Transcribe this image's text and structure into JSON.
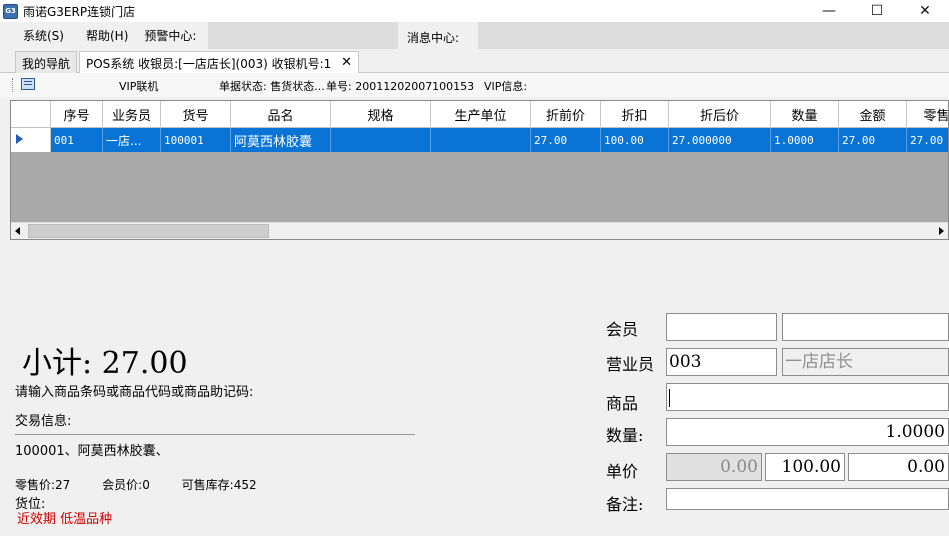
{
  "window": {
    "title": "雨诺G3ERP连锁门店",
    "icon_text": "G3",
    "controls": [
      "—",
      "☐",
      "✕"
    ]
  },
  "menu": {
    "items": [
      "系统(S)",
      "帮助(H)",
      "预警中心:"
    ],
    "message_center": "消息中心:"
  },
  "tabs": [
    {
      "label": "我的导航"
    },
    {
      "label": "POS系统 收银员:[一店店长](003) 收银机号:1",
      "close": "✕"
    }
  ],
  "toolbar": {
    "vip_mode": "VIP联机",
    "doc_status": "单据状态: 售货状态...",
    "doc_no": "单号: 20011202007100153",
    "vip_info": "VIP信息:"
  },
  "grid": {
    "columns": [
      "序号",
      "业务员",
      "货号",
      "品名",
      "规格",
      "生产单位",
      "折前价",
      "折扣",
      "折后价",
      "数量",
      "金额",
      "零售"
    ],
    "rows": [
      [
        "001",
        "一店...",
        "100001",
        "阿莫西林胶囊",
        "",
        "",
        "27.00",
        "100.00",
        "27.000000",
        "1.0000",
        "27.00",
        "27.00"
      ]
    ]
  },
  "summary": {
    "subtotal": "小计: 27.00",
    "prompt": "请输入商品条码或商品代码或商品助记码:",
    "trade_label": "交易信息:",
    "trade_text": "100001、阿莫西林胶囊、",
    "retail_price": "零售价:27",
    "member_price": "会员价:0",
    "stock": "可售库存:452",
    "location": "货位:",
    "warning": "近效期 低温品种"
  },
  "form": {
    "member_label": "会员",
    "member_id": "",
    "member_name": "",
    "salesperson_label": "营业员",
    "salesperson_id": "003",
    "salesperson_name": "一店店长",
    "product_label": "商品",
    "product_value": "",
    "quantity_label": "数量:",
    "quantity_value": "1.0000",
    "unit_price_label": "单价",
    "unit_price_1": "0.00",
    "unit_price_2": "100.00",
    "unit_price_3": "0.00",
    "note_label": "备注:",
    "note_value": ""
  }
}
